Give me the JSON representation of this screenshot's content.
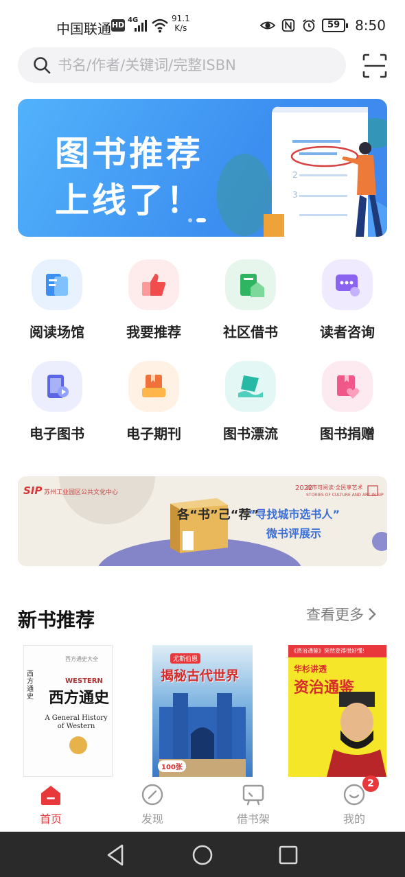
{
  "status": {
    "carrier": "中国联通",
    "hd": "HD",
    "network": "4G",
    "speed_value": "91.1",
    "speed_unit": "K/s",
    "battery": "59",
    "time": "8:50"
  },
  "search": {
    "placeholder": "书名/作者/关键词/完整ISBN"
  },
  "banner": {
    "line1": "图书推荐",
    "line2": "上线了！"
  },
  "grid": [
    {
      "label": "阅读场馆",
      "icon": "reading-hall-icon"
    },
    {
      "label": "我要推荐",
      "icon": "thumbs-up-icon"
    },
    {
      "label": "社区借书",
      "icon": "community-icon"
    },
    {
      "label": "读者咨询",
      "icon": "chat-icon"
    },
    {
      "label": "电子图书",
      "icon": "ebook-icon"
    },
    {
      "label": "电子期刊",
      "icon": "journal-icon"
    },
    {
      "label": "图书漂流",
      "icon": "book-drift-icon"
    },
    {
      "label": "图书捐赠",
      "icon": "donate-icon"
    }
  ],
  "campaign": {
    "logo": "SIP",
    "org": "苏州工业园区公共文化中心",
    "year": "2022",
    "slogan_cn": "城市可阅读·全民享艺术",
    "slogan_en": "STORIES OF CULTURE AND ART IN SIP",
    "box_text": "各“书”己“荐”",
    "title": "“寻找城市选书人”",
    "subtitle": "微书评展示"
  },
  "new_books": {
    "title": "新书推荐",
    "more": "查看更多"
  },
  "books": [
    {
      "cover_title": "西方通史",
      "en_title": "A General History of Western",
      "brand": "WESTERN",
      "series": "西方通史大全"
    },
    {
      "cover_title": "揭秘古代世界",
      "series": "尤斯伯恩",
      "badge": "100张"
    },
    {
      "cover_title": "资治通鉴",
      "author": "华杉讲透",
      "banner": "《资治通鉴》突然变得很好懂!"
    }
  ],
  "tabs": [
    {
      "label": "首页",
      "active": true
    },
    {
      "label": "发现",
      "active": false
    },
    {
      "label": "借书架",
      "active": false
    },
    {
      "label": "我的",
      "active": false,
      "badge": "2"
    }
  ],
  "colors": {
    "accent": "#e8383b",
    "banner_blue": "#3f8ff0",
    "campaign_blue": "#3a6fd8"
  }
}
